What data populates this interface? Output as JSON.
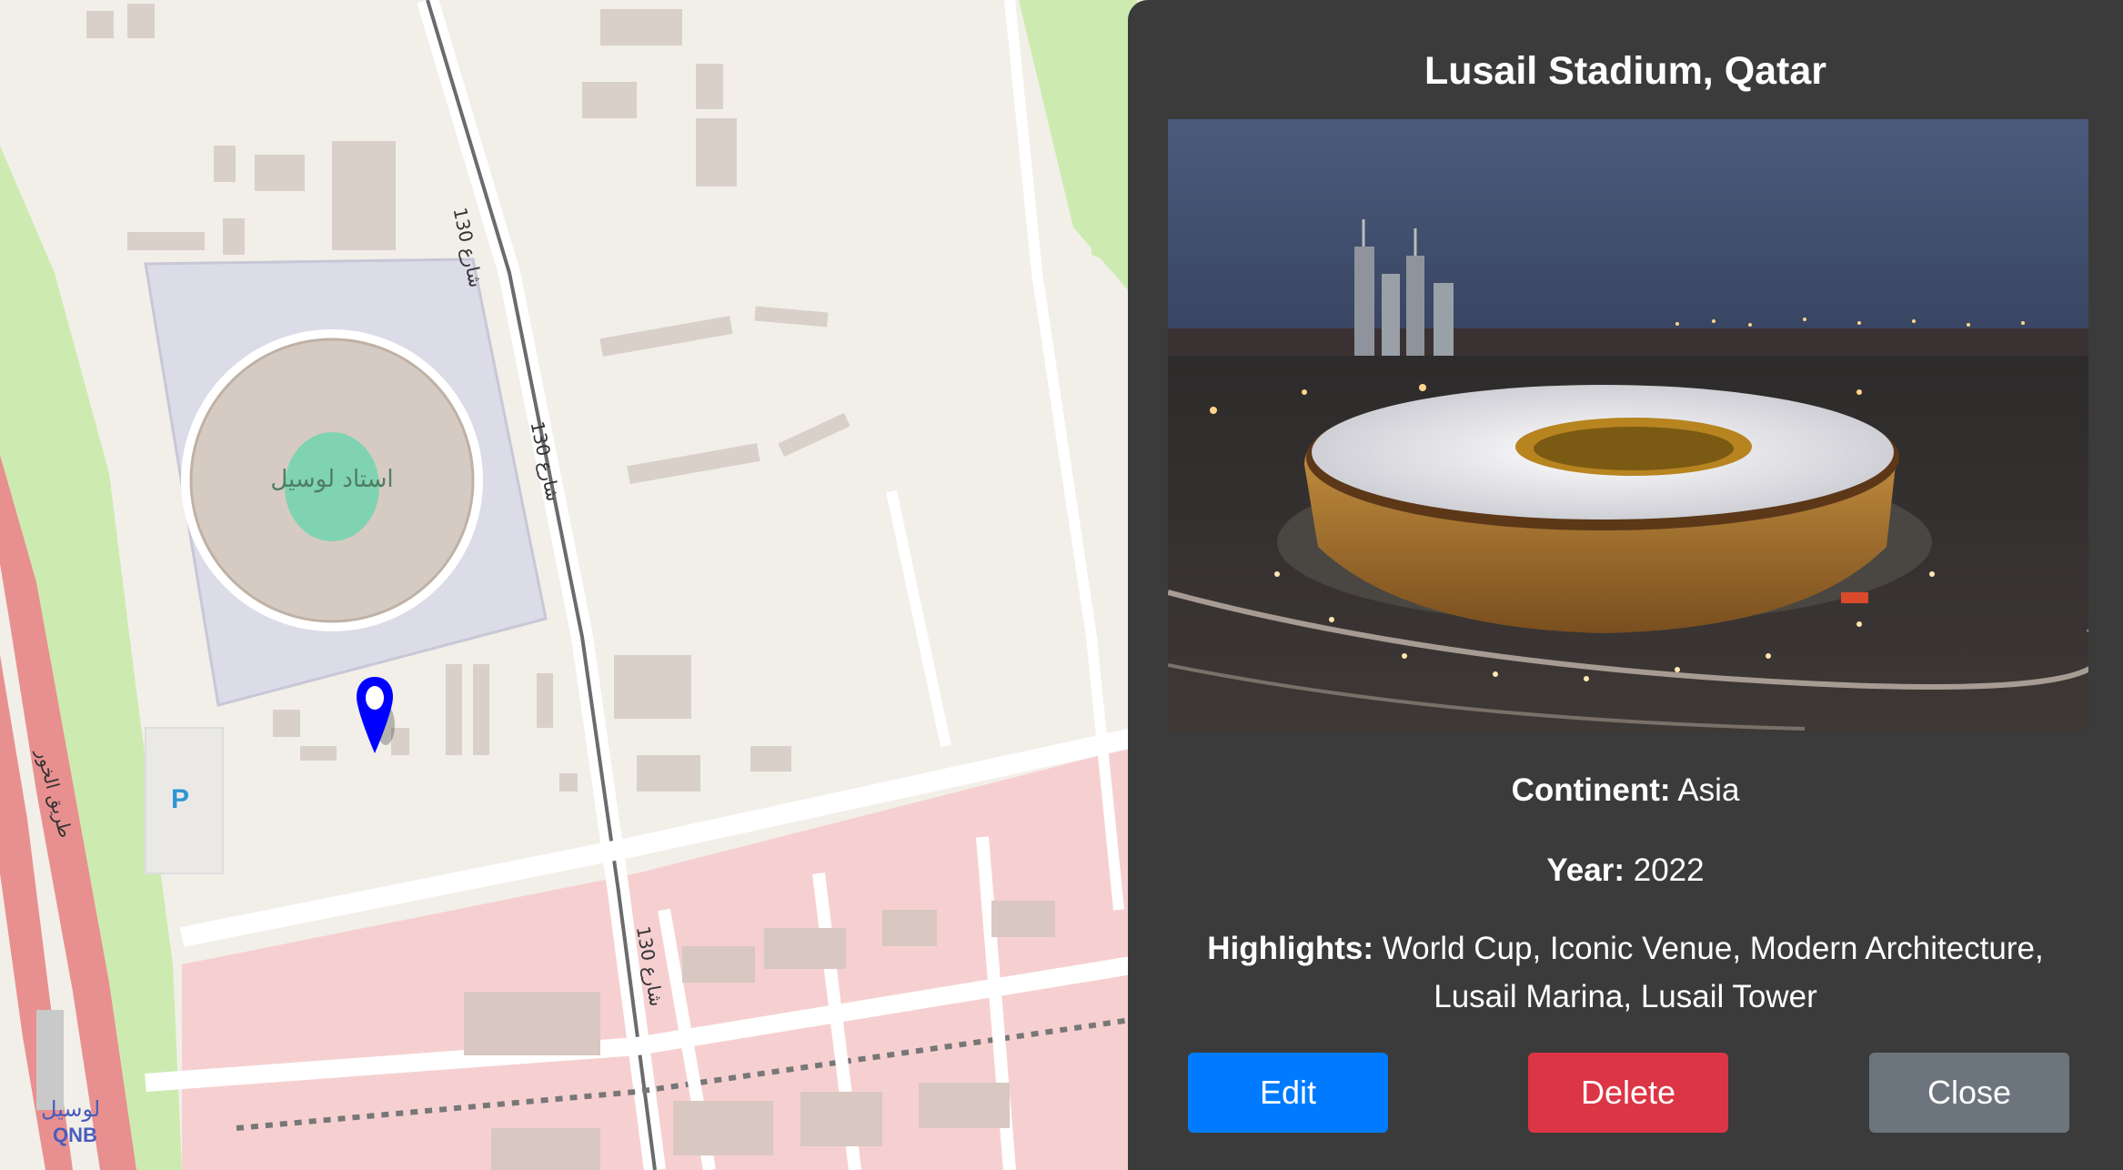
{
  "map": {
    "stadium_label": "استاد لوسيل",
    "road_label_1": "شارع 130",
    "road_label_2": "شارع 130",
    "road_label_3": "شارع 130",
    "highway_label": "طريق الخور",
    "parking_label": "P",
    "station_label": "لوسيل",
    "station_sub": "QNB",
    "marker_icon": "map-pin-icon",
    "marker_color": "#0000ff"
  },
  "popup": {
    "title": "Lusail Stadium, Qatar",
    "continent_label": "Continent:",
    "continent_value": "Asia",
    "year_label": "Year:",
    "year_value": "2022",
    "highlights_label": "Highlights:",
    "highlights_value_line1": "World Cup, Iconic Venue, Modern Architecture,",
    "highlights_value_line2": "Lusail Marina, Lusail Tower",
    "image_alt": "Aerial night photo of Lusail Stadium"
  },
  "buttons": {
    "edit": "Edit",
    "delete": "Delete",
    "close": "Close"
  },
  "colors": {
    "panel_bg": "#3b3b3b",
    "edit": "#007bff",
    "delete": "#dc3545",
    "close": "#6c757d"
  }
}
